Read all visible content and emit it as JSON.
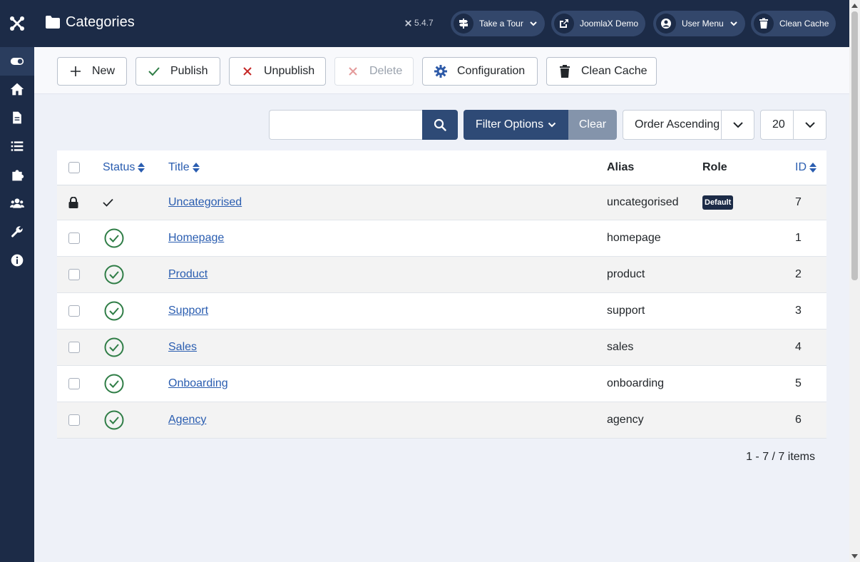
{
  "header": {
    "title": "Categories",
    "version": "5.4.7",
    "buttons": [
      {
        "label": "Take a Tour",
        "icon": "signpost-icon"
      },
      {
        "label": "JoomlaX Demo",
        "icon": "external-link-icon"
      },
      {
        "label": "User Menu",
        "icon": "user-circle-icon"
      },
      {
        "label": "Clean Cache",
        "icon": "trash-icon"
      }
    ]
  },
  "sidebar": {
    "items": [
      {
        "name": "toggle-menu",
        "icon": "toggle-icon"
      },
      {
        "name": "home",
        "icon": "home-icon"
      },
      {
        "name": "content",
        "icon": "file-icon"
      },
      {
        "name": "menus",
        "icon": "list-icon"
      },
      {
        "name": "components",
        "icon": "puzzle-icon"
      },
      {
        "name": "users",
        "icon": "users-icon"
      },
      {
        "name": "system",
        "icon": "wrench-icon"
      },
      {
        "name": "help",
        "icon": "info-icon"
      }
    ]
  },
  "toolbar": {
    "new_label": "New",
    "publish_label": "Publish",
    "unpublish_label": "Unpublish",
    "delete_label": "Delete",
    "configuration_label": "Configuration",
    "clean_cache_label": "Clean Cache"
  },
  "filters": {
    "search_placeholder": "",
    "filter_options_label": "Filter Options",
    "clear_label": "Clear",
    "ordering": "Order Ascending",
    "limit": "20"
  },
  "table": {
    "headers": {
      "status": "Status",
      "title": "Title",
      "alias": "Alias",
      "role": "Role",
      "id": "ID"
    },
    "rows": [
      {
        "title": "Uncategorised",
        "alias": "uncategorised",
        "role": "Default",
        "id": "7",
        "locked": true
      },
      {
        "title": "Homepage",
        "alias": "homepage",
        "role": "",
        "id": "1"
      },
      {
        "title": "Product",
        "alias": "product",
        "role": "",
        "id": "2"
      },
      {
        "title": "Support",
        "alias": "support",
        "role": "",
        "id": "3"
      },
      {
        "title": "Sales",
        "alias": "sales",
        "role": "",
        "id": "4"
      },
      {
        "title": "Onboarding",
        "alias": "onboarding",
        "role": "",
        "id": "5"
      },
      {
        "title": "Agency",
        "alias": "agency",
        "role": "",
        "id": "6"
      }
    ]
  },
  "pagination": {
    "info": "1 - 7 / 7 items"
  },
  "colors": {
    "navy": "#1c2b47",
    "primary": "#2e4a76",
    "link": "#2a5db0",
    "success": "#2f7d46",
    "danger": "#c52827"
  }
}
